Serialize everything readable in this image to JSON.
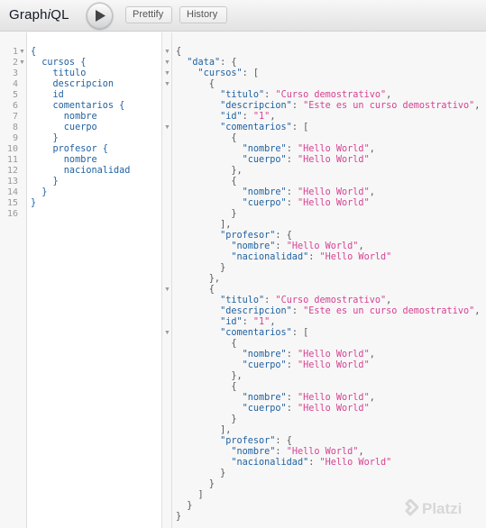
{
  "app": {
    "title_prefix": "Graph",
    "title_italic": "i",
    "title_suffix": "QL"
  },
  "toolbar": {
    "execute_label": "Execute Query",
    "prettify_label": "Prettify",
    "history_label": "History"
  },
  "query_editor": {
    "line_numbers": "1\n2\n3\n4\n5\n6\n7\n8\n9\n10\n11\n12\n13\n14\n15\n16",
    "text": "{\n  cursos {\n    titulo\n    descripcion\n    id\n    comentarios {\n      nombre\n      cuerpo\n    }\n    profesor {\n      nombre\n      nacionalidad\n    }\n  }\n}\n"
  },
  "result": {
    "lines": [
      [
        "p:{"
      ],
      [
        "p:  ",
        "k:\"data\"",
        "p:: {"
      ],
      [
        "p:    ",
        "k:\"cursos\"",
        "p:: ["
      ],
      [
        "p:      {"
      ],
      [
        "p:        ",
        "k:\"titulo\"",
        "p:: ",
        "s:\"Curso demostrativo\"",
        "p:,"
      ],
      [
        "p:        ",
        "k:\"descripcion\"",
        "p:: ",
        "s:\"Este es un curso demostrativo\"",
        "p:,"
      ],
      [
        "p:        ",
        "k:\"id\"",
        "p:: ",
        "s:\"1\"",
        "p:,"
      ],
      [
        "p:        ",
        "k:\"comentarios\"",
        "p:: ["
      ],
      [
        "p:          {"
      ],
      [
        "p:            ",
        "k:\"nombre\"",
        "p:: ",
        "s:\"Hello World\"",
        "p:,"
      ],
      [
        "p:            ",
        "k:\"cuerpo\"",
        "p:: ",
        "s:\"Hello World\""
      ],
      [
        "p:          },"
      ],
      [
        "p:          {"
      ],
      [
        "p:            ",
        "k:\"nombre\"",
        "p:: ",
        "s:\"Hello World\"",
        "p:,"
      ],
      [
        "p:            ",
        "k:\"cuerpo\"",
        "p:: ",
        "s:\"Hello World\""
      ],
      [
        "p:          }"
      ],
      [
        "p:        ],"
      ],
      [
        "p:        ",
        "k:\"profesor\"",
        "p:: {"
      ],
      [
        "p:          ",
        "k:\"nombre\"",
        "p:: ",
        "s:\"Hello World\"",
        "p:,"
      ],
      [
        "p:          ",
        "k:\"nacionalidad\"",
        "p:: ",
        "s:\"Hello World\""
      ],
      [
        "p:        }"
      ],
      [
        "p:      },"
      ],
      [
        "p:      {"
      ],
      [
        "p:        ",
        "k:\"titulo\"",
        "p:: ",
        "s:\"Curso demostrativo\"",
        "p:,"
      ],
      [
        "p:        ",
        "k:\"descripcion\"",
        "p:: ",
        "s:\"Este es un curso demostrativo\"",
        "p:,"
      ],
      [
        "p:        ",
        "k:\"id\"",
        "p:: ",
        "s:\"1\"",
        "p:,"
      ],
      [
        "p:        ",
        "k:\"comentarios\"",
        "p:: ["
      ],
      [
        "p:          {"
      ],
      [
        "p:            ",
        "k:\"nombre\"",
        "p:: ",
        "s:\"Hello World\"",
        "p:,"
      ],
      [
        "p:            ",
        "k:\"cuerpo\"",
        "p:: ",
        "s:\"Hello World\""
      ],
      [
        "p:          },"
      ],
      [
        "p:          {"
      ],
      [
        "p:            ",
        "k:\"nombre\"",
        "p:: ",
        "s:\"Hello World\"",
        "p:,"
      ],
      [
        "p:            ",
        "k:\"cuerpo\"",
        "p:: ",
        "s:\"Hello World\""
      ],
      [
        "p:          }"
      ],
      [
        "p:        ],"
      ],
      [
        "p:        ",
        "k:\"profesor\"",
        "p:: {"
      ],
      [
        "p:          ",
        "k:\"nombre\"",
        "p:: ",
        "s:\"Hello World\"",
        "p:,"
      ],
      [
        "p:          ",
        "k:\"nacionalidad\"",
        "p:: ",
        "s:\"Hello World\""
      ],
      [
        "p:        }"
      ],
      [
        "p:      }"
      ],
      [
        "p:    ]"
      ],
      [
        "p:  }"
      ],
      [
        "p:}"
      ]
    ]
  },
  "watermark": {
    "text": "Platzi",
    "icon": "platzi-logo-icon"
  },
  "colors": {
    "key": "#1f61a0",
    "string": "#d64292",
    "punctuation": "#555555"
  }
}
